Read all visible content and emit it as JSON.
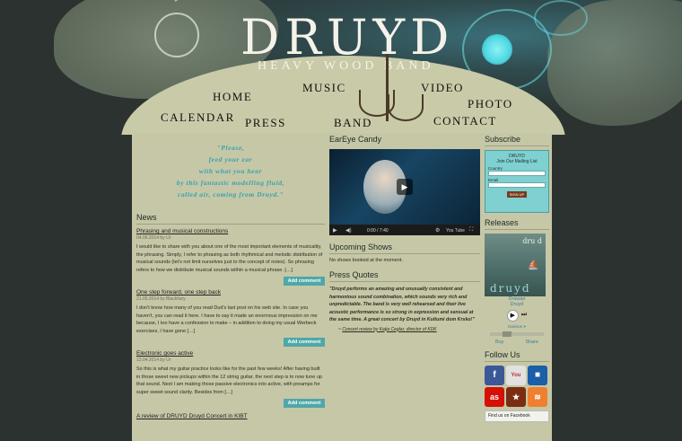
{
  "header": {
    "logo": "DRUYD",
    "tagline": "HEAVY WOOD BAND",
    "nav": [
      {
        "label": "HOME"
      },
      {
        "label": "MUSIC"
      },
      {
        "label": "VIDEO"
      },
      {
        "label": "PHOTO"
      },
      {
        "label": "CALENDAR"
      },
      {
        "label": "PRESS"
      },
      {
        "label": "BAND"
      },
      {
        "label": "CONTACT"
      }
    ]
  },
  "left": {
    "quote_lines": [
      "\"Please,",
      "feed your ear",
      "with what you hear",
      "by this fantastic modelling fluid,",
      "called air, coming from Druyd.\""
    ],
    "news_title": "News",
    "posts": [
      {
        "title": "Phrasing and musical constructions",
        "meta": "04.06.2014 by Ur",
        "body": "I would like to share with you about one of the most important elements of musicality, the phrasing. Simply, I refer to phrasing as both rhythmical and melodic distribution of musical sounds (let's not limit ourselves just to the concept of notes). So phrasing refers to how we distribute musical sounds within a musical phrase. […]",
        "button": "Add comment"
      },
      {
        "title": "One step forward, one step back",
        "meta": "21.05.2014 by Blackfairy",
        "body": "I don't know how many of you read Dud's last post on his web site.  In case you haven't, you can read it here.  I have to say it made an enormous impression on me because, I too have a confession to make – in addition to doing my usual Werbeck exercises, I have gone […]",
        "button": "Add comment"
      },
      {
        "title": "Electronic goes active",
        "meta": "13.04.2014 by Ur",
        "body": "So this is what my guitar practice looks like for the past few weeks! After having built in those sweet new pickups within the 12 string guitar, the next step is to now tune up that sound. Next I am making those passive electronics into active, with preamps for super sweet sound clarity. Besides from […]",
        "button": "Add comment"
      }
    ],
    "cutoff_title": "A review of DRUYD Druyd Concert in KIBT"
  },
  "middle": {
    "eareye_title": "EarEye Candy",
    "video_time": "0:00 / 7:40",
    "video_logo": "You Tube",
    "upcoming_title": "Upcoming Shows",
    "upcoming_text": "No shows booked at the moment.",
    "press_title": "Press Quotes",
    "press_quote": "\"Druyd performs an amazing and unusually consistent and harmonious sound combination, which sounds very rich and unpredictable. The band is very well rehearsed and their live acoustic performance is so strong in expression and sensual at the same time. A great concert by Druyd in Kultumi dom Krsko!\"",
    "press_cite_prefix": "~ ",
    "press_cite_link": "Concert review by Katja Ceglar, director of KDK"
  },
  "right": {
    "subscribe_title": "Subscribe",
    "sub_brand": "DRUYD",
    "sub_join": "Join Our Mailing List",
    "sub_country_label": "Country",
    "sub_email_label": "Email",
    "sub_button": "SIGN UP",
    "releases_title": "Releases",
    "album_art_top": "dru d",
    "album_art_bottom": "druyd",
    "album_name": "Drawao",
    "album_artist": "Druyd",
    "track_select": "Davison",
    "buy": "Buy",
    "share": "Share",
    "follow_title": "Follow Us",
    "facebook_box": "Find us on Facebook"
  },
  "colors": {
    "accent": "#4fa7a9",
    "content_bg": "#c6c7a6",
    "quote": "#33a2b0",
    "link": "#3c7d9a"
  }
}
